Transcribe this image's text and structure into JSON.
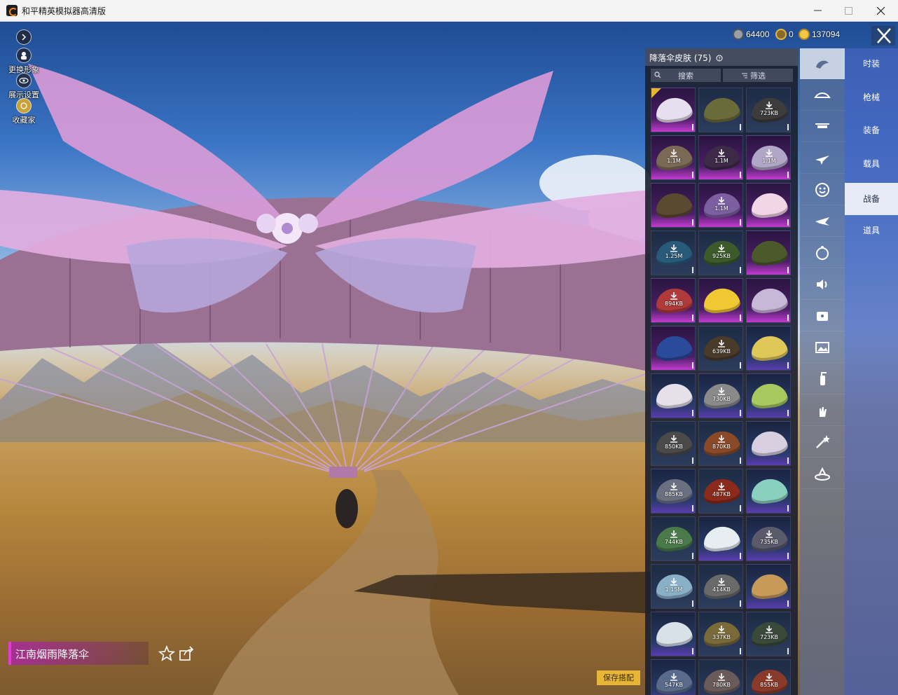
{
  "window": {
    "title": "和平精英模拟器高清版"
  },
  "hud": {
    "change_look": "更换形象",
    "display_settings": "展示设置",
    "collection": "收藏家"
  },
  "currency": {
    "silver": "64400",
    "coupon": "0",
    "gold": "137094"
  },
  "panel": {
    "title": "降落伞皮肤 (75)",
    "search_label": "搜索",
    "filter_label": "筛选",
    "tiles": [
      {
        "size": "",
        "rarity": "epic",
        "color": "#e6dfee",
        "owned": true
      },
      {
        "size": "",
        "rarity": "none",
        "color": "#6b6b3a",
        "owned": false
      },
      {
        "size": "723KB",
        "rarity": "none",
        "color": "#3c3c3c",
        "owned": false
      },
      {
        "size": "1.1M",
        "rarity": "epic",
        "color": "#7a6a55",
        "owned": false
      },
      {
        "size": "1.1M",
        "rarity": "epic",
        "color": "#3c2a48",
        "owned": false
      },
      {
        "size": "1.1M",
        "rarity": "epic",
        "color": "#b0a6c6",
        "owned": false
      },
      {
        "size": "",
        "rarity": "epic",
        "color": "#5a4a30",
        "owned": false
      },
      {
        "size": "1.1M",
        "rarity": "epic",
        "color": "#7b5fa0",
        "owned": false
      },
      {
        "size": "",
        "rarity": "epic",
        "color": "#f2d6e6",
        "owned": false
      },
      {
        "size": "1.25M",
        "rarity": "none",
        "color": "#2a5a7a",
        "owned": false
      },
      {
        "size": "925KB",
        "rarity": "none",
        "color": "#3d5a2a",
        "owned": false
      },
      {
        "size": "",
        "rarity": "epic",
        "color": "#4a5a2a",
        "owned": false
      },
      {
        "size": "894KB",
        "rarity": "epic",
        "color": "#b03a3a",
        "owned": false
      },
      {
        "size": "",
        "rarity": "epic",
        "color": "#f0c832",
        "owned": false
      },
      {
        "size": "",
        "rarity": "epic",
        "color": "#c8b8d8",
        "owned": false
      },
      {
        "size": "",
        "rarity": "epic",
        "color": "#2a4a9a",
        "owned": false
      },
      {
        "size": "639KB",
        "rarity": "none",
        "color": "#4a3a2a",
        "owned": false
      },
      {
        "size": "",
        "rarity": "rare",
        "color": "#e0c858",
        "owned": false
      },
      {
        "size": "",
        "rarity": "rare",
        "color": "#e6e0ea",
        "owned": false
      },
      {
        "size": "730KB",
        "rarity": "rare",
        "color": "#8a8a8a",
        "owned": false
      },
      {
        "size": "",
        "rarity": "rare",
        "color": "#a8c860",
        "owned": false
      },
      {
        "size": "850KB",
        "rarity": "none",
        "color": "#4a4a4a",
        "owned": false
      },
      {
        "size": "870KB",
        "rarity": "none",
        "color": "#8a4a2a",
        "owned": false
      },
      {
        "size": "",
        "rarity": "rare",
        "color": "#d8d0e0",
        "owned": false
      },
      {
        "size": "885KB",
        "rarity": "rare",
        "color": "#6a7080",
        "owned": false
      },
      {
        "size": "487KB",
        "rarity": "none",
        "color": "#8a2a1a",
        "owned": false
      },
      {
        "size": "",
        "rarity": "rare",
        "color": "#8ad0c0",
        "owned": false
      },
      {
        "size": "744KB",
        "rarity": "none",
        "color": "#4a7a4a",
        "owned": false
      },
      {
        "size": "",
        "rarity": "rare",
        "color": "#e6eef2",
        "owned": false
      },
      {
        "size": "735KB",
        "rarity": "rare",
        "color": "#5a5a6a",
        "owned": false
      },
      {
        "size": "1.15M",
        "rarity": "none",
        "color": "#8ab0c8",
        "owned": false
      },
      {
        "size": "414KB",
        "rarity": "none",
        "color": "#6a6a6a",
        "owned": false
      },
      {
        "size": "",
        "rarity": "rare",
        "color": "#c89a5a",
        "owned": false
      },
      {
        "size": "",
        "rarity": "rare",
        "color": "#d8e0e8",
        "owned": false
      },
      {
        "size": "337KB",
        "rarity": "none",
        "color": "#7a6a3a",
        "owned": false
      },
      {
        "size": "723KB",
        "rarity": "none",
        "color": "#3a4a3a",
        "owned": false
      },
      {
        "size": "547KB",
        "rarity": "rare",
        "color": "#5a6a8a",
        "owned": false
      },
      {
        "size": "780KB",
        "rarity": "none",
        "color": "#6a5a5a",
        "owned": false
      },
      {
        "size": "855KB",
        "rarity": "none",
        "color": "#8a3a2a",
        "owned": false
      }
    ]
  },
  "categories": [
    {
      "icon": "outfit-icon",
      "active": true
    },
    {
      "icon": "hat-icon",
      "active": false
    },
    {
      "icon": "drone-icon",
      "active": false
    },
    {
      "icon": "plane-icon",
      "active": false
    },
    {
      "icon": "emote-icon",
      "active": false
    },
    {
      "icon": "glider-icon",
      "active": false
    },
    {
      "icon": "companion-icon",
      "active": false
    },
    {
      "icon": "sound-icon",
      "active": false
    },
    {
      "icon": "card-icon",
      "active": false
    },
    {
      "icon": "frame-icon",
      "active": false
    },
    {
      "icon": "extinguisher-icon",
      "active": false
    },
    {
      "icon": "hand-effect-icon",
      "active": false
    },
    {
      "icon": "wand-icon",
      "active": false
    },
    {
      "icon": "landing-effect-icon",
      "active": false
    }
  ],
  "menu": {
    "items": [
      "时装",
      "枪械",
      "装备",
      "载具",
      "战备",
      "道具"
    ],
    "active_index": 4
  },
  "selection": {
    "item_name": "江南烟雨降落伞",
    "save_label": "保存搭配"
  },
  "colors": {
    "accent_gold": "#e8b636",
    "epic_purple": "#c23bd0",
    "menu_blue": "#4664be"
  }
}
